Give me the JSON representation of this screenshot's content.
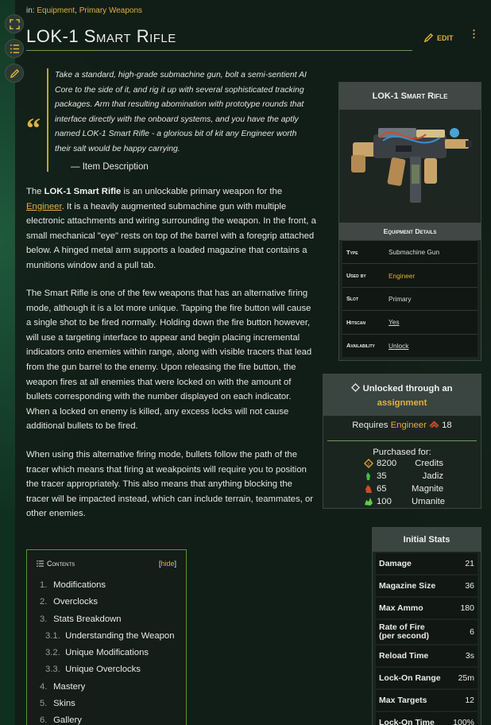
{
  "breadcrumb": {
    "prefix": "in:",
    "links": [
      "Equipment",
      "Primary Weapons"
    ],
    "sep": ","
  },
  "title": "LOK-1 Smart Rifle",
  "header_actions": {
    "edit_label": "EDIT",
    "more_label": "⋮"
  },
  "sidetools": [
    {
      "icon": "fullscreen-icon"
    },
    {
      "icon": "toc-list-icon"
    },
    {
      "icon": "pencil-icon"
    }
  ],
  "quote": {
    "mark": "“",
    "text": "Take a standard, high-grade submachine gun, bolt a semi-sentient AI Core to the side of it, and rig it up with several sophisticated tracking packages. Arm that resulting abomination with prototype rounds that interface directly with the onboard systems, and you have the aptly named LOK-1 Smart Rifle - a glorious bit of kit any Engineer worth their salt would be happy carrying.",
    "source": "— Item Description"
  },
  "paragraphs": {
    "p1": {
      "a": "The ",
      "bold": "LOK-1 Smart Rifle",
      "b": " is an unlockable primary weapon for the ",
      "link": "Engineer",
      "c": ". It is a heavily augmented submachine gun with multiple electronic attachments and wiring surrounding the weapon. In the front, a small mechanical \"eye\" rests on top of the barrel with a foregrip attached below. A hinged metal arm supports a loaded magazine that contains a munitions window and a pull tab."
    },
    "p2": "The Smart Rifle is one of the few weapons that has an alternative firing mode, although it is a lot more unique. Tapping the fire button will cause a single shot to be fired normally. Holding down the fire button however, will use a targeting interface to appear and begin placing incremental indicators onto enemies within range, along with visible tracers that lead from the gun barrel to the enemy. Upon releasing the fire button, the weapon fires at all enemies that were locked on with the amount of bullets corresponding with the number displayed on each indicator. When a locked on enemy is killed, any excess locks will not cause additional bullets to be fired.",
    "p3": "When using this alternative firing mode, bullets follow the path of the tracer which means that firing at weakpoints will require you to position the tracer appropriately. This also means that anything blocking the tracer will be impacted instead, which can include terrain, teammates, or other enemies."
  },
  "infobox": {
    "title": "LOK-1 Smart Rifle",
    "section": "Equipment Details",
    "rows": [
      {
        "k": "Type",
        "v": "Submachine Gun"
      },
      {
        "k": "Used by",
        "v": "Engineer"
      },
      {
        "k": "Slot",
        "v": "Primary"
      },
      {
        "k": "Hitscan",
        "v": "Yes"
      },
      {
        "k": "Availability",
        "v": "Unlock"
      }
    ]
  },
  "unlock": {
    "line1": "Unlocked through an",
    "line2": "assignment",
    "req_prefix": "Requires",
    "req_class": "Engineer",
    "req_level": "18",
    "purchased": "Purchased for:",
    "costs": [
      {
        "amt": "8200",
        "name": "Credits",
        "icon": "credits-icon",
        "color": "#e0a030"
      },
      {
        "amt": "35",
        "name": "Jadiz",
        "icon": "jadiz-icon",
        "color": "#3fbf3f"
      },
      {
        "amt": "65",
        "name": "Magnite",
        "icon": "magnite-icon",
        "color": "#d04a2a"
      },
      {
        "amt": "100",
        "name": "Umanite",
        "icon": "umanite-icon",
        "color": "#5ad040"
      }
    ]
  },
  "stats": {
    "title": "Initial Stats",
    "rows": [
      {
        "k": "Damage",
        "v": "21"
      },
      {
        "k": "Magazine Size",
        "v": "36"
      },
      {
        "k": "Max Ammo",
        "v": "180"
      },
      {
        "k": "Rate of Fire (per second)",
        "v": "6"
      },
      {
        "k": "Reload Time",
        "v": "3s"
      },
      {
        "k": "Lock-On Range",
        "v": "25m"
      },
      {
        "k": "Max Targets",
        "v": "12"
      },
      {
        "k": "Lock-On Time",
        "v": "100%"
      }
    ]
  },
  "toc": {
    "title": "Contents",
    "hide_open": "[",
    "hide": "hide",
    "hide_close": "]",
    "items": [
      {
        "n": "1.",
        "t": "Modifications"
      },
      {
        "n": "2.",
        "t": "Overclocks"
      },
      {
        "n": "3.",
        "t": "Stats Breakdown"
      },
      {
        "n": "3.1.",
        "t": "Understanding the Weapon"
      },
      {
        "n": "3.2.",
        "t": "Unique Modifications"
      },
      {
        "n": "3.3.",
        "t": "Unique Overclocks"
      },
      {
        "n": "4.",
        "t": "Mastery"
      },
      {
        "n": "5.",
        "t": "Skins"
      },
      {
        "n": "6.",
        "t": "Gallery"
      }
    ]
  },
  "colors": {
    "accent": "#e0b040",
    "rule": "#6a9a5a",
    "toc_border": "#4e9a40"
  }
}
